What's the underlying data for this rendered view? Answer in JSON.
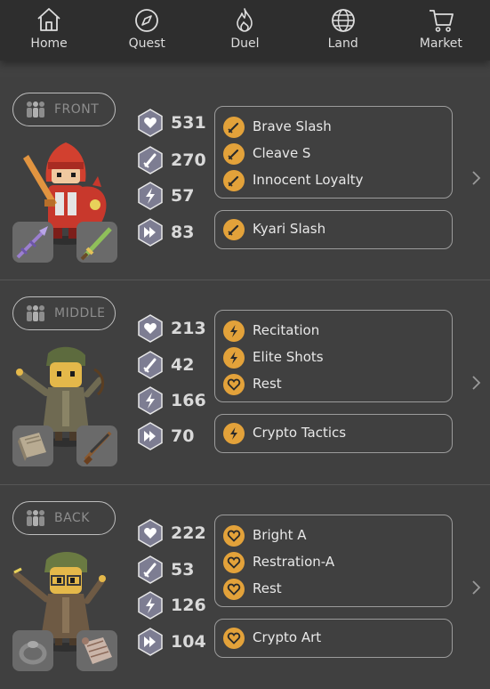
{
  "nav": [
    {
      "label": "Home",
      "icon": "home-icon"
    },
    {
      "label": "Quest",
      "icon": "compass-icon"
    },
    {
      "label": "Duel",
      "icon": "flame-icon"
    },
    {
      "label": "Land",
      "icon": "globe-icon"
    },
    {
      "label": "Market",
      "icon": "cart-icon"
    }
  ],
  "colors": {
    "accent": "#e3a23a",
    "background": "#414141",
    "nav_bg": "#2e2e2e",
    "hex_fill": "#7d7d92"
  },
  "units": [
    {
      "position": "FRONT",
      "stats": {
        "hp": "531",
        "attack": "270",
        "magic": "57",
        "speed": "83"
      },
      "skills": [
        {
          "label": "Brave Slash",
          "icon": "sword-icon"
        },
        {
          "label": "Cleave S",
          "icon": "sword-icon"
        },
        {
          "label": "Innocent Loyalty",
          "icon": "sword-icon"
        }
      ],
      "special": {
        "label": "Kyari Slash",
        "icon": "sword-icon"
      }
    },
    {
      "position": "MIDDLE",
      "stats": {
        "hp": "213",
        "attack": "42",
        "magic": "166",
        "speed": "70"
      },
      "skills": [
        {
          "label": "Recitation",
          "icon": "lightning-icon"
        },
        {
          "label": "Elite Shots",
          "icon": "lightning-icon"
        },
        {
          "label": "Rest",
          "icon": "heart-icon"
        }
      ],
      "special": {
        "label": "Crypto Tactics",
        "icon": "lightning-icon"
      }
    },
    {
      "position": "BACK",
      "stats": {
        "hp": "222",
        "attack": "53",
        "magic": "126",
        "speed": "104"
      },
      "skills": [
        {
          "label": "Bright A",
          "icon": "heart-icon"
        },
        {
          "label": "Restration-A",
          "icon": "heart-icon"
        },
        {
          "label": "Rest",
          "icon": "heart-icon"
        }
      ],
      "special": {
        "label": "Crypto Art",
        "icon": "heart-icon"
      }
    }
  ]
}
